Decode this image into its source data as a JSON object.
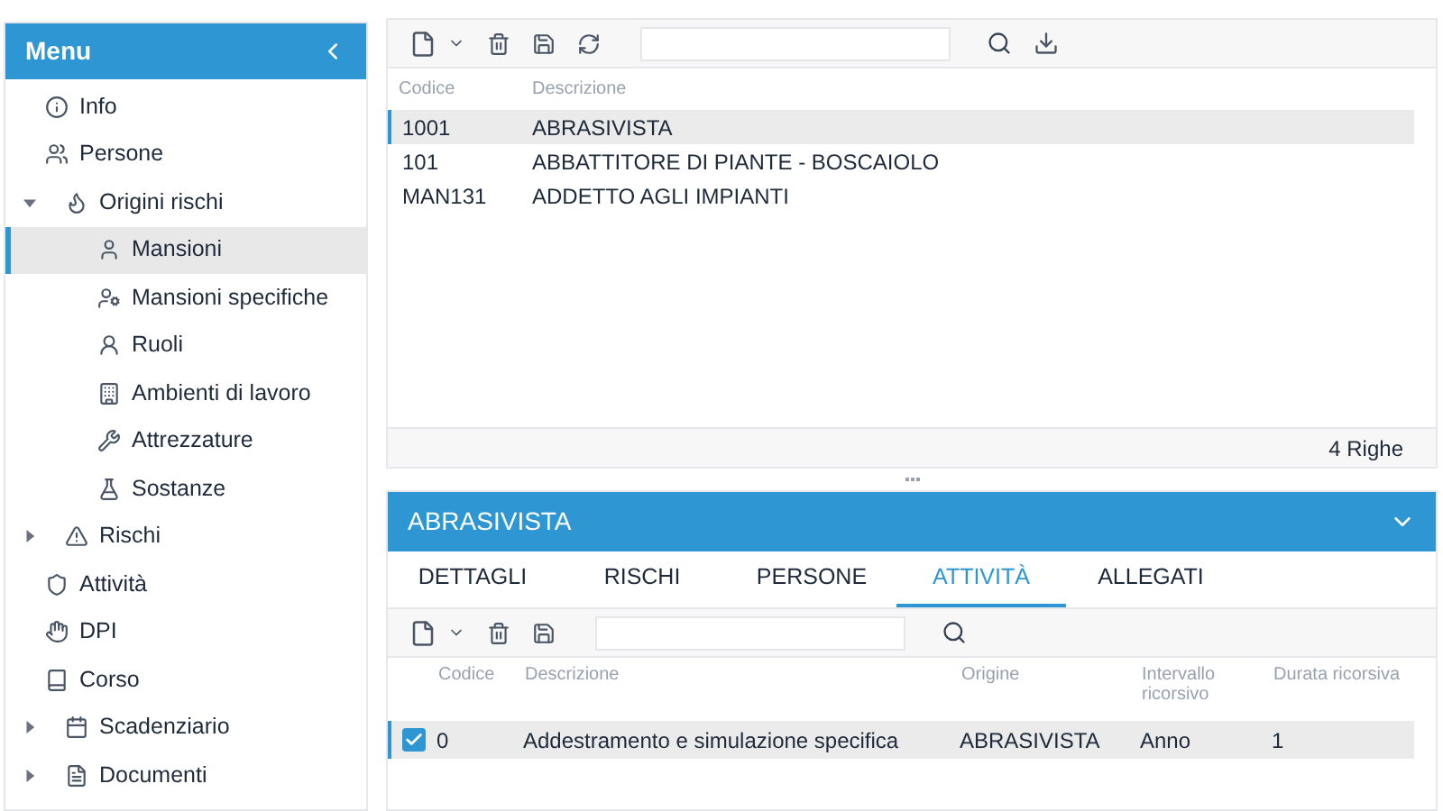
{
  "sidebar": {
    "title": "Menu",
    "items": [
      {
        "label": "Info",
        "selected": false
      },
      {
        "label": "Persone",
        "selected": false
      },
      {
        "label": "Origini rischi",
        "selected": false,
        "expanded": true,
        "children": [
          {
            "label": "Mansioni",
            "selected": true
          },
          {
            "label": "Mansioni specifiche",
            "selected": false
          },
          {
            "label": "Ruoli",
            "selected": false
          },
          {
            "label": "Ambienti di lavoro",
            "selected": false
          },
          {
            "label": "Attrezzature",
            "selected": false
          },
          {
            "label": "Sostanze",
            "selected": false
          }
        ]
      },
      {
        "label": "Rischi",
        "selected": false,
        "expanded": false
      },
      {
        "label": "Attività",
        "selected": false
      },
      {
        "label": "DPI",
        "selected": false
      },
      {
        "label": "Corso",
        "selected": false
      },
      {
        "label": "Scadenziario",
        "selected": false,
        "expanded": false
      },
      {
        "label": "Documenti",
        "selected": false,
        "expanded": false
      }
    ]
  },
  "table": {
    "columns": [
      "Codice",
      "Descrizione"
    ],
    "rows": [
      {
        "cells": [
          "1001",
          "ABRASIVISTA"
        ],
        "selected": true
      },
      {
        "cells": [
          "101",
          "ABBATTITORE DI PIANTE - BOSCAIOLO"
        ],
        "selected": false
      },
      {
        "cells": [
          "MAN131",
          "ADDETTO AGLI IMPIANTI"
        ],
        "selected": false
      }
    ],
    "footer": "4 Righe"
  },
  "detail": {
    "title": "ABRASIVISTA",
    "tabs": [
      {
        "label": "DETTAGLI",
        "selected": false
      },
      {
        "label": "RISCHI",
        "selected": false
      },
      {
        "label": "PERSONE",
        "selected": false
      },
      {
        "label": "ATTIVITÀ",
        "selected": true
      },
      {
        "label": "ALLEGATI",
        "selected": false
      }
    ],
    "table": {
      "columns": [
        "Codice",
        "Descrizione",
        "Origine",
        "Intervallo ricorsivo",
        "Durata ricorsiva"
      ],
      "rows": [
        {
          "checked": true,
          "cells": [
            "0",
            "Addestramento e simulazione specifica",
            "ABRASIVISTA",
            "Anno",
            "1"
          ]
        }
      ]
    }
  }
}
